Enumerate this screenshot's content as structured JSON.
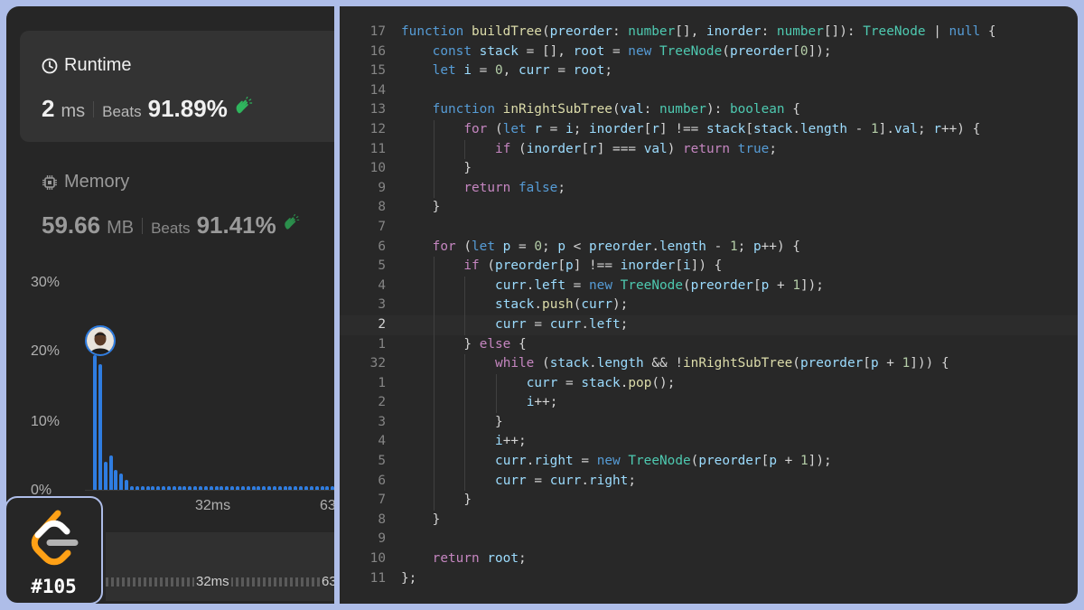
{
  "runtime": {
    "title": "Runtime",
    "value": "2",
    "unit": "ms",
    "beats_label": "Beats",
    "beats": "91.89%"
  },
  "memory": {
    "title": "Memory",
    "value": "59.66",
    "unit": "MB",
    "beats_label": "Beats",
    "beats": "91.41%"
  },
  "distribution": {
    "y_ticks": [
      "30%",
      "20%",
      "10%",
      "0%"
    ],
    "x_ticks": [
      "32ms",
      "63"
    ],
    "mini_ticks": [
      "32ms",
      "63"
    ],
    "bar_heights_pct": [
      19.4,
      18.0,
      4.0,
      4.9,
      2.9,
      2.3,
      1.4,
      0.5,
      0.5,
      0.5,
      0.5,
      0.5,
      0.5,
      0.5,
      0.5,
      0.5,
      0.5,
      0.5,
      0.5,
      0.5,
      0.5,
      0.5,
      0.5,
      0.5,
      0.5,
      0.5,
      0.5,
      0.5,
      0.5,
      0.5,
      0.5,
      0.5,
      0.5,
      0.5,
      0.5,
      0.5,
      0.5,
      0.5,
      0.5,
      0.5,
      0.5,
      0.5,
      0.5,
      0.5,
      0.5,
      0.5,
      0.5,
      0.5
    ],
    "bar_color": "#2f7de1"
  },
  "badge": {
    "label": "#105",
    "logo_colors": [
      "#ffa116",
      "#ffffff",
      "#b3b3b3"
    ]
  },
  "code": {
    "active_line_index": 15,
    "lines": [
      {
        "n": "17",
        "indent": 0,
        "t": [
          [
            "kw",
            "function "
          ],
          [
            "fn",
            "buildTree"
          ],
          [
            "op",
            "("
          ],
          [
            "vr",
            "preorder"
          ],
          [
            "op",
            ": "
          ],
          [
            "ty",
            "number"
          ],
          [
            "op",
            "[], "
          ],
          [
            "vr",
            "inorder"
          ],
          [
            "op",
            ": "
          ],
          [
            "ty",
            "number"
          ],
          [
            "op",
            "[]): "
          ],
          [
            "ty",
            "TreeNode"
          ],
          [
            "op",
            " | "
          ],
          [
            "kw",
            "null"
          ],
          [
            "op",
            " {"
          ]
        ]
      },
      {
        "n": "16",
        "indent": 1,
        "t": [
          [
            "kw",
            "const "
          ],
          [
            "vr",
            "stack"
          ],
          [
            "op",
            " = [], "
          ],
          [
            "vr",
            "root"
          ],
          [
            "op",
            " = "
          ],
          [
            "kw",
            "new "
          ],
          [
            "ty",
            "TreeNode"
          ],
          [
            "op",
            "("
          ],
          [
            "vr",
            "preorder"
          ],
          [
            "op",
            "["
          ],
          [
            "nm",
            "0"
          ],
          [
            "op",
            "]);"
          ]
        ]
      },
      {
        "n": "15",
        "indent": 1,
        "t": [
          [
            "kw",
            "let "
          ],
          [
            "vr",
            "i"
          ],
          [
            "op",
            " = "
          ],
          [
            "nm",
            "0"
          ],
          [
            "op",
            ", "
          ],
          [
            "vr",
            "curr"
          ],
          [
            "op",
            " = "
          ],
          [
            "vr",
            "root"
          ],
          [
            "op",
            ";"
          ]
        ]
      },
      {
        "n": "14",
        "indent": 0,
        "t": []
      },
      {
        "n": "13",
        "indent": 1,
        "t": [
          [
            "kw",
            "function "
          ],
          [
            "fn",
            "inRightSubTree"
          ],
          [
            "op",
            "("
          ],
          [
            "vr",
            "val"
          ],
          [
            "op",
            ": "
          ],
          [
            "ty",
            "number"
          ],
          [
            "op",
            "): "
          ],
          [
            "ty",
            "boolean"
          ],
          [
            "op",
            " {"
          ]
        ]
      },
      {
        "n": "12",
        "indent": 2,
        "t": [
          [
            "ctl",
            "for "
          ],
          [
            "op",
            "("
          ],
          [
            "kw",
            "let "
          ],
          [
            "vr",
            "r"
          ],
          [
            "op",
            " = "
          ],
          [
            "vr",
            "i"
          ],
          [
            "op",
            "; "
          ],
          [
            "vr",
            "inorder"
          ],
          [
            "op",
            "["
          ],
          [
            "vr",
            "r"
          ],
          [
            "op",
            "] !== "
          ],
          [
            "vr",
            "stack"
          ],
          [
            "op",
            "["
          ],
          [
            "vr",
            "stack"
          ],
          [
            "op",
            "."
          ],
          [
            "vr",
            "length"
          ],
          [
            "op",
            " - "
          ],
          [
            "nm",
            "1"
          ],
          [
            "op",
            "]."
          ],
          [
            "vr",
            "val"
          ],
          [
            "op",
            "; "
          ],
          [
            "vr",
            "r"
          ],
          [
            "op",
            "++) {"
          ]
        ]
      },
      {
        "n": "11",
        "indent": 3,
        "t": [
          [
            "ctl",
            "if "
          ],
          [
            "op",
            "("
          ],
          [
            "vr",
            "inorder"
          ],
          [
            "op",
            "["
          ],
          [
            "vr",
            "r"
          ],
          [
            "op",
            "] === "
          ],
          [
            "vr",
            "val"
          ],
          [
            "op",
            ") "
          ],
          [
            "ctl",
            "return "
          ],
          [
            "kw",
            "true"
          ],
          [
            "op",
            ";"
          ]
        ]
      },
      {
        "n": "10",
        "indent": 2,
        "t": [
          [
            "op",
            "}"
          ]
        ]
      },
      {
        "n": "9",
        "indent": 2,
        "t": [
          [
            "ctl",
            "return "
          ],
          [
            "kw",
            "false"
          ],
          [
            "op",
            ";"
          ]
        ]
      },
      {
        "n": "8",
        "indent": 1,
        "t": [
          [
            "op",
            "}"
          ]
        ]
      },
      {
        "n": "7",
        "indent": 0,
        "t": []
      },
      {
        "n": "6",
        "indent": 1,
        "t": [
          [
            "ctl",
            "for "
          ],
          [
            "op",
            "("
          ],
          [
            "kw",
            "let "
          ],
          [
            "vr",
            "p"
          ],
          [
            "op",
            " = "
          ],
          [
            "nm",
            "0"
          ],
          [
            "op",
            "; "
          ],
          [
            "vr",
            "p"
          ],
          [
            "op",
            " < "
          ],
          [
            "vr",
            "preorder"
          ],
          [
            "op",
            "."
          ],
          [
            "vr",
            "length"
          ],
          [
            "op",
            " - "
          ],
          [
            "nm",
            "1"
          ],
          [
            "op",
            "; "
          ],
          [
            "vr",
            "p"
          ],
          [
            "op",
            "++) {"
          ]
        ]
      },
      {
        "n": "5",
        "indent": 2,
        "t": [
          [
            "ctl",
            "if "
          ],
          [
            "op",
            "("
          ],
          [
            "vr",
            "preorder"
          ],
          [
            "op",
            "["
          ],
          [
            "vr",
            "p"
          ],
          [
            "op",
            "] !== "
          ],
          [
            "vr",
            "inorder"
          ],
          [
            "op",
            "["
          ],
          [
            "vr",
            "i"
          ],
          [
            "op",
            "]) {"
          ]
        ]
      },
      {
        "n": "4",
        "indent": 3,
        "t": [
          [
            "vr",
            "curr"
          ],
          [
            "op",
            "."
          ],
          [
            "vr",
            "left"
          ],
          [
            "op",
            " = "
          ],
          [
            "kw",
            "new "
          ],
          [
            "ty",
            "TreeNode"
          ],
          [
            "op",
            "("
          ],
          [
            "vr",
            "preorder"
          ],
          [
            "op",
            "["
          ],
          [
            "vr",
            "p"
          ],
          [
            "op",
            " + "
          ],
          [
            "nm",
            "1"
          ],
          [
            "op",
            "]);"
          ]
        ]
      },
      {
        "n": "3",
        "indent": 3,
        "t": [
          [
            "vr",
            "stack"
          ],
          [
            "op",
            "."
          ],
          [
            "fn",
            "push"
          ],
          [
            "op",
            "("
          ],
          [
            "vr",
            "curr"
          ],
          [
            "op",
            ");"
          ]
        ]
      },
      {
        "n": "2",
        "indent": 3,
        "t": [
          [
            "vr",
            "curr"
          ],
          [
            "op",
            " = "
          ],
          [
            "vr",
            "curr"
          ],
          [
            "op",
            "."
          ],
          [
            "vr",
            "left"
          ],
          [
            "op",
            ";"
          ]
        ]
      },
      {
        "n": "1",
        "indent": 2,
        "t": [
          [
            "op",
            "} "
          ],
          [
            "ctl",
            "else"
          ],
          [
            "op",
            " {"
          ]
        ]
      },
      {
        "n": "32",
        "indent": 3,
        "t": [
          [
            "ctl",
            "while "
          ],
          [
            "op",
            "("
          ],
          [
            "vr",
            "stack"
          ],
          [
            "op",
            "."
          ],
          [
            "vr",
            "length"
          ],
          [
            "op",
            " && !"
          ],
          [
            "fn",
            "inRightSubTree"
          ],
          [
            "op",
            "("
          ],
          [
            "vr",
            "preorder"
          ],
          [
            "op",
            "["
          ],
          [
            "vr",
            "p"
          ],
          [
            "op",
            " + "
          ],
          [
            "nm",
            "1"
          ],
          [
            "op",
            "])) {"
          ]
        ]
      },
      {
        "n": "1",
        "indent": 4,
        "t": [
          [
            "vr",
            "curr"
          ],
          [
            "op",
            " = "
          ],
          [
            "vr",
            "stack"
          ],
          [
            "op",
            "."
          ],
          [
            "fn",
            "pop"
          ],
          [
            "op",
            "();"
          ]
        ]
      },
      {
        "n": "2",
        "indent": 4,
        "t": [
          [
            "vr",
            "i"
          ],
          [
            "op",
            "++;"
          ]
        ]
      },
      {
        "n": "3",
        "indent": 3,
        "t": [
          [
            "op",
            "}"
          ]
        ]
      },
      {
        "n": "4",
        "indent": 3,
        "t": [
          [
            "vr",
            "i"
          ],
          [
            "op",
            "++;"
          ]
        ]
      },
      {
        "n": "5",
        "indent": 3,
        "t": [
          [
            "vr",
            "curr"
          ],
          [
            "op",
            "."
          ],
          [
            "vr",
            "right"
          ],
          [
            "op",
            " = "
          ],
          [
            "kw",
            "new "
          ],
          [
            "ty",
            "TreeNode"
          ],
          [
            "op",
            "("
          ],
          [
            "vr",
            "preorder"
          ],
          [
            "op",
            "["
          ],
          [
            "vr",
            "p"
          ],
          [
            "op",
            " + "
          ],
          [
            "nm",
            "1"
          ],
          [
            "op",
            "]);"
          ]
        ]
      },
      {
        "n": "6",
        "indent": 3,
        "t": [
          [
            "vr",
            "curr"
          ],
          [
            "op",
            " = "
          ],
          [
            "vr",
            "curr"
          ],
          [
            "op",
            "."
          ],
          [
            "vr",
            "right"
          ],
          [
            "op",
            ";"
          ]
        ]
      },
      {
        "n": "7",
        "indent": 2,
        "t": [
          [
            "op",
            "}"
          ]
        ]
      },
      {
        "n": "8",
        "indent": 1,
        "t": [
          [
            "op",
            "}"
          ]
        ]
      },
      {
        "n": "9",
        "indent": 0,
        "t": []
      },
      {
        "n": "10",
        "indent": 1,
        "t": [
          [
            "ctl",
            "return "
          ],
          [
            "vr",
            "root"
          ],
          [
            "op",
            ";"
          ]
        ]
      },
      {
        "n": "11",
        "indent": 0,
        "t": [
          [
            "op",
            "};"
          ]
        ]
      }
    ]
  }
}
